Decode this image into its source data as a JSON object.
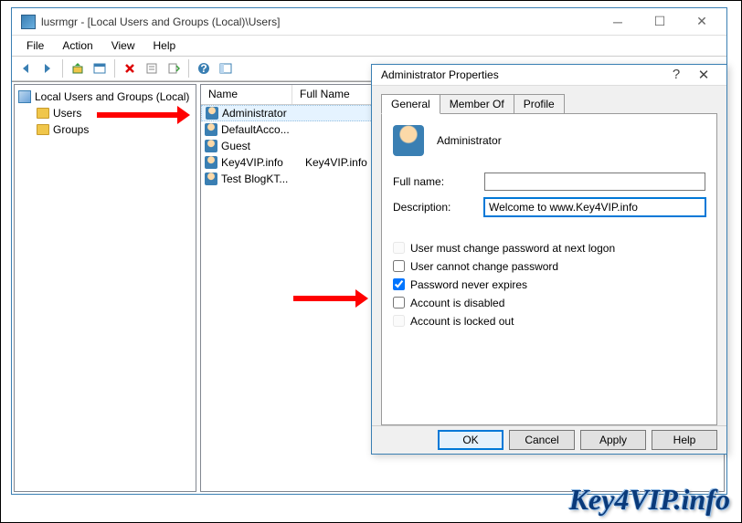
{
  "window": {
    "title": "lusrmgr - [Local Users and Groups (Local)\\Users]",
    "menus": [
      "File",
      "Action",
      "View",
      "Help"
    ]
  },
  "tree": {
    "root": "Local Users and Groups (Local)",
    "items": [
      "Users",
      "Groups"
    ]
  },
  "list": {
    "headers": {
      "name": "Name",
      "fullname": "Full Name"
    },
    "rows": [
      {
        "name": "Administrator",
        "full": ""
      },
      {
        "name": "DefaultAcco...",
        "full": ""
      },
      {
        "name": "Guest",
        "full": ""
      },
      {
        "name": "Key4VIP.info",
        "full": "Key4VIP.info"
      },
      {
        "name": "Test BlogKT...",
        "full": ""
      }
    ]
  },
  "dialog": {
    "title": "Administrator Properties",
    "tabs": {
      "general": "General",
      "memberof": "Member Of",
      "profile": "Profile"
    },
    "username": "Administrator",
    "labels": {
      "fullname": "Full name:",
      "description": "Description:"
    },
    "fields": {
      "fullname": "",
      "description": "Welcome to www.Key4VIP.info"
    },
    "checks": {
      "mustchange": "User must change password at next logon",
      "cannotchange": "User cannot change password",
      "neverexpires": "Password never expires",
      "disabled": "Account is disabled",
      "lockedout": "Account is locked out"
    },
    "buttons": {
      "ok": "OK",
      "cancel": "Cancel",
      "apply": "Apply",
      "help": "Help"
    }
  },
  "watermark": "Key4VIP.info"
}
